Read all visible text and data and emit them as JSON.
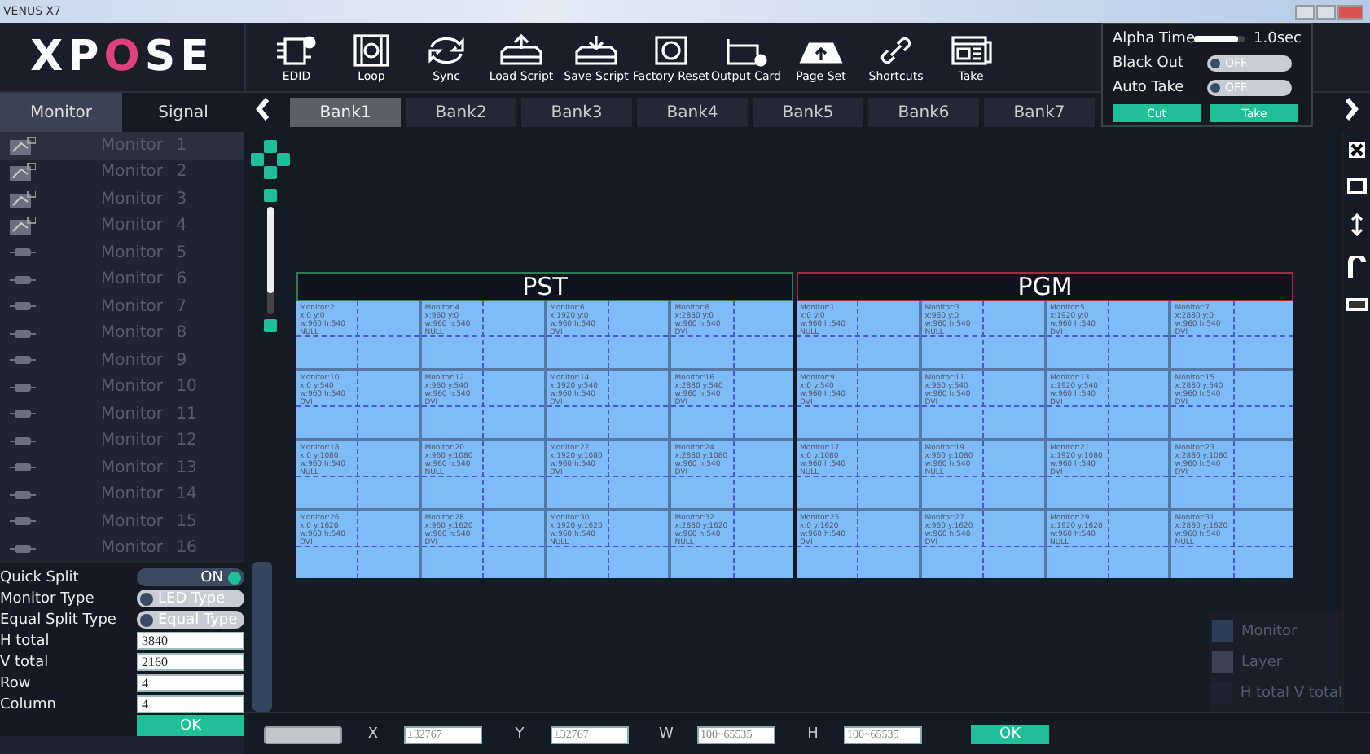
{
  "window": {
    "title": "VENUS X7"
  },
  "logo": {
    "text": "XPOSE"
  },
  "toolbar": [
    {
      "label": "EDID"
    },
    {
      "label": "Loop"
    },
    {
      "label": "Sync"
    },
    {
      "label": "Load Script"
    },
    {
      "label": "Save Script"
    },
    {
      "label": "Factory Reset"
    },
    {
      "label": "Output Card"
    },
    {
      "label": "Page Set"
    },
    {
      "label": "Shortcuts"
    },
    {
      "label": "Take"
    }
  ],
  "zoom": {
    "level": 0.8
  },
  "side_tabs": [
    {
      "label": "Monitor",
      "selected": true
    },
    {
      "label": "Signal",
      "selected": false
    }
  ],
  "banks": [
    {
      "label": "Bank1",
      "selected": true
    },
    {
      "label": "Bank2",
      "selected": false
    },
    {
      "label": "Bank3",
      "selected": false
    },
    {
      "label": "Bank4",
      "selected": false
    },
    {
      "label": "Bank5",
      "selected": false
    },
    {
      "label": "Bank6",
      "selected": false
    },
    {
      "label": "Bank7",
      "selected": false
    }
  ],
  "monitors": [
    {
      "label": "Monitor 1",
      "kind": "display",
      "selected": true
    },
    {
      "label": "Monitor 2",
      "kind": "display",
      "selected": false
    },
    {
      "label": "Monitor 3",
      "kind": "display",
      "selected": false
    },
    {
      "label": "Monitor 4",
      "kind": "display",
      "selected": false
    },
    {
      "label": "Monitor 5",
      "kind": "connector",
      "selected": false
    },
    {
      "label": "Monitor 6",
      "kind": "connector",
      "selected": false
    },
    {
      "label": "Monitor 7",
      "kind": "connector",
      "selected": false
    },
    {
      "label": "Monitor 8",
      "kind": "connector",
      "selected": false
    },
    {
      "label": "Monitor 9",
      "kind": "connector",
      "selected": false
    },
    {
      "label": "Monitor 10",
      "kind": "connector",
      "selected": false
    },
    {
      "label": "Monitor 11",
      "kind": "connector",
      "selected": false
    },
    {
      "label": "Monitor 12",
      "kind": "connector",
      "selected": false
    },
    {
      "label": "Monitor 13",
      "kind": "connector",
      "selected": false
    },
    {
      "label": "Monitor 14",
      "kind": "connector",
      "selected": false
    },
    {
      "label": "Monitor 15",
      "kind": "connector",
      "selected": false
    },
    {
      "label": "Monitor 16",
      "kind": "connector",
      "selected": false
    }
  ],
  "quick_panel": {
    "alpha_time": {
      "label": "Alpha Time",
      "level": 0.9,
      "reading": "1.0sec"
    },
    "switches": [
      {
        "label": "Black Out",
        "value": "OFF",
        "on": false
      },
      {
        "label": "Auto Take",
        "value": "OFF",
        "on": false
      }
    ],
    "buttons": [
      "Cut",
      "Take"
    ]
  },
  "form": {
    "rows": [
      {
        "kind": "toggle",
        "label": "Quick Split",
        "value": "ON",
        "on": true
      },
      {
        "kind": "toggle",
        "label": "Monitor Type",
        "value": "LED Type",
        "on": false
      },
      {
        "kind": "toggle",
        "label": "Equal Split Type",
        "value": "Equal Type",
        "on": false
      },
      {
        "kind": "input",
        "label": "H total",
        "value": "3840"
      },
      {
        "kind": "input",
        "label": "V total",
        "value": "2160"
      },
      {
        "kind": "input",
        "label": "Row",
        "value": "4"
      },
      {
        "kind": "input",
        "label": "Column",
        "value": "4"
      }
    ],
    "ok": "OK"
  },
  "previews": [
    {
      "title": "PST",
      "color": "#2e7d4f",
      "cells": [
        {
          "name": "Monitor:2",
          "position": "x:0 y:0",
          "size": "w:960 h:540",
          "signal": "NULL"
        },
        {
          "name": "Monitor:4",
          "position": "x:960 y:0",
          "size": "w:960 h:540",
          "signal": "NULL"
        },
        {
          "name": "Monitor:6",
          "position": "x:1920 y:0",
          "size": "w:960 h:540",
          "signal": "DVI"
        },
        {
          "name": "Monitor:8",
          "position": "x:2880 y:0",
          "size": "w:960 h:540",
          "signal": "DVI"
        },
        {
          "name": "Monitor:10",
          "position": "x:0 y:540",
          "size": "w:960 h:540",
          "signal": "DVI"
        },
        {
          "name": "Monitor:12",
          "position": "x:960 y:540",
          "size": "w:960 h:540",
          "signal": "DVI"
        },
        {
          "name": "Monitor:14",
          "position": "x:1920 y:540",
          "size": "w:960 h:540",
          "signal": "DVI"
        },
        {
          "name": "Monitor:16",
          "position": "x:2880 y:540",
          "size": "w:960 h:540",
          "signal": "DVI"
        },
        {
          "name": "Monitor:18",
          "position": "x:0 y:1080",
          "size": "w:960 h:540",
          "signal": "NULL"
        },
        {
          "name": "Monitor:20",
          "position": "x:960 y:1080",
          "size": "w:960 h:540",
          "signal": "NULL"
        },
        {
          "name": "Monitor:22",
          "position": "x:1920 y:1080",
          "size": "w:960 h:540",
          "signal": "DVI"
        },
        {
          "name": "Monitor:24",
          "position": "x:2880 y:1080",
          "size": "w:960 h:540",
          "signal": "DVI"
        },
        {
          "name": "Monitor:26",
          "position": "x:0 y:1620",
          "size": "w:960 h:540",
          "signal": "DVI"
        },
        {
          "name": "Monitor:28",
          "position": "x:960 y:1620",
          "size": "w:960 h:540",
          "signal": "DVI"
        },
        {
          "name": "Monitor:30",
          "position": "x:1920 y:1620",
          "size": "w:960 h:540",
          "signal": "NULL"
        },
        {
          "name": "Monitor:32",
          "position": "x:2880 y:1620",
          "size": "w:960 h:540",
          "signal": "NULL"
        }
      ]
    },
    {
      "title": "PGM",
      "color": "#a8293a",
      "cells": [
        {
          "name": "Monitor:1",
          "position": "x:0 y:0",
          "size": "w:960 h:540",
          "signal": "NULL"
        },
        {
          "name": "Monitor:3",
          "position": "x:960 y:0",
          "size": "w:960 h:540",
          "signal": "NULL"
        },
        {
          "name": "Monitor:5",
          "position": "x:1920 y:0",
          "size": "w:960 h:540",
          "signal": "DVI"
        },
        {
          "name": "Monitor:7",
          "position": "x:2880 y:0",
          "size": "w:960 h:540",
          "signal": "DVI"
        },
        {
          "name": "Monitor:9",
          "position": "x:0 y:540",
          "size": "w:960 h:540",
          "signal": "DVI"
        },
        {
          "name": "Monitor:11",
          "position": "x:960 y:540",
          "size": "w:960 h:540",
          "signal": "DVI"
        },
        {
          "name": "Monitor:13",
          "position": "x:1920 y:540",
          "size": "w:960 h:540",
          "signal": "DVI"
        },
        {
          "name": "Monitor:15",
          "position": "x:2880 y:540",
          "size": "w:960 h:540",
          "signal": "DVI"
        },
        {
          "name": "Monitor:17",
          "position": "x:0 y:1080",
          "size": "w:960 h:540",
          "signal": "NULL"
        },
        {
          "name": "Monitor:19",
          "position": "x:960 y:1080",
          "size": "w:960 h:540",
          "signal": "NULL"
        },
        {
          "name": "Monitor:21",
          "position": "x:1920 y:1080",
          "size": "w:960 h:540",
          "signal": "DVI"
        },
        {
          "name": "Monitor:23",
          "position": "x:2880 y:1080",
          "size": "w:960 h:540",
          "signal": "DVI"
        },
        {
          "name": "Monitor:25",
          "position": "x:0 y:1620",
          "size": "w:960 h:540",
          "signal": "DVI"
        },
        {
          "name": "Monitor:27",
          "position": "x:960 y:1620",
          "size": "w:960 h:540",
          "signal": "DVI"
        },
        {
          "name": "Monitor:29",
          "position": "x:1920 y:1620",
          "size": "w:960 h:540",
          "signal": "NULL"
        },
        {
          "name": "Monitor:31",
          "position": "x:2880 y:1620",
          "size": "w:960 h:540",
          "signal": "NULL"
        }
      ]
    }
  ],
  "legend": [
    {
      "label": "Monitor",
      "color": "#2e3d57"
    },
    {
      "label": "Layer",
      "color": "#3d4155"
    },
    {
      "label": "H total V total",
      "color": "#1e2333"
    }
  ],
  "bottom_bar": {
    "fields": [
      {
        "label": "X",
        "placeholder": "±32767"
      },
      {
        "label": "Y",
        "placeholder": "±32767"
      },
      {
        "label": "W",
        "placeholder": "100~65535"
      },
      {
        "label": "H",
        "placeholder": "100~65535"
      }
    ],
    "ok": "OK"
  }
}
